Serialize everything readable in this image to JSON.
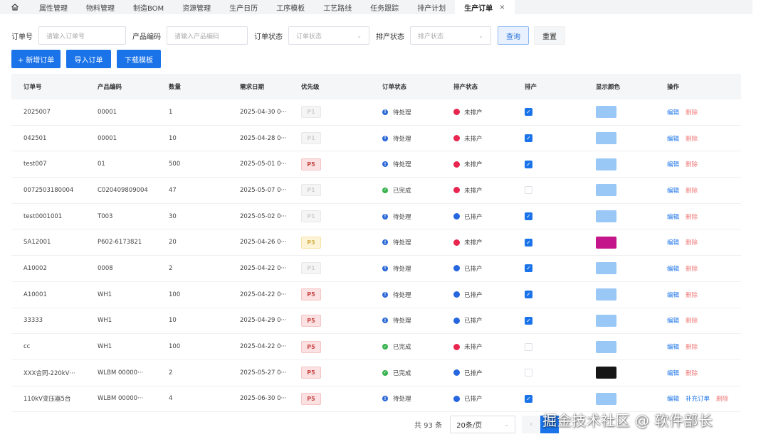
{
  "tabs": [
    {
      "label": "属性管理"
    },
    {
      "label": "物料管理"
    },
    {
      "label": "制造BOM"
    },
    {
      "label": "资源管理"
    },
    {
      "label": "生产日历"
    },
    {
      "label": "工序模板"
    },
    {
      "label": "工艺路线"
    },
    {
      "label": "任务跟踪"
    },
    {
      "label": "排产计划"
    },
    {
      "label": "生产订单",
      "active": true
    }
  ],
  "filters": {
    "order_no_label": "订单号",
    "order_no_placeholder": "请输入订单号",
    "product_code_label": "产品编码",
    "product_code_placeholder": "请输入产品编码",
    "order_status_label": "订单状态",
    "order_status_placeholder": "订单状态",
    "schedule_status_label": "排产状态",
    "schedule_status_placeholder": "排产状态",
    "query_label": "查询",
    "reset_label": "重置"
  },
  "actions": {
    "add_label": "+ 新增订单",
    "import_label": "导入订单",
    "download_label": "下载模板"
  },
  "table": {
    "headers": [
      "订单号",
      "产品编码",
      "数量",
      "需求日期",
      "优先级",
      "订单状态",
      "排产状态",
      "排产",
      "显示颜色",
      "操作"
    ],
    "rows": [
      {
        "order": "2025007",
        "code": "00001",
        "qty": "1",
        "date": "2025-04-30 0···",
        "prio": "P1",
        "ostatus": "待处理",
        "sstatus": "未排产",
        "checked": true,
        "color": "#99c8f7"
      },
      {
        "order": "042501",
        "code": "00001",
        "qty": "10",
        "date": "2025-04-28 0···",
        "prio": "P1",
        "ostatus": "待处理",
        "sstatus": "未排产",
        "checked": true,
        "color": "#99c8f7"
      },
      {
        "order": "test007",
        "code": "01",
        "qty": "500",
        "date": "2025-05-01 0···",
        "prio": "P5",
        "ostatus": "待处理",
        "sstatus": "未排产",
        "checked": true,
        "color": "#99c8f7"
      },
      {
        "order": "0072503180004",
        "code": "C020409809004",
        "qty": "47",
        "date": "2025-05-07 0···",
        "prio": "P1",
        "ostatus": "已完成",
        "sstatus": "未排产",
        "checked": false,
        "color": "#99c8f7"
      },
      {
        "order": "test0001001",
        "code": "T003",
        "qty": "30",
        "date": "2025-05-02 0···",
        "prio": "P1",
        "ostatus": "待处理",
        "sstatus": "已排产",
        "checked": true,
        "color": "#99c8f7"
      },
      {
        "order": "SA12001",
        "code": "P602-6173821",
        "qty": "20",
        "date": "2025-04-26 0···",
        "prio": "P3",
        "ostatus": "待处理",
        "sstatus": "未排产",
        "checked": true,
        "color": "#c4168a"
      },
      {
        "order": "A10002",
        "code": "0008",
        "qty": "2",
        "date": "2025-04-22 0···",
        "prio": "P1",
        "ostatus": "待处理",
        "sstatus": "已排产",
        "checked": true,
        "color": "#99c8f7"
      },
      {
        "order": "A10001",
        "code": "WH1",
        "qty": "100",
        "date": "2025-04-22 0···",
        "prio": "P5",
        "ostatus": "待处理",
        "sstatus": "已排产",
        "checked": true,
        "color": "#99c8f7"
      },
      {
        "order": "33333",
        "code": "WH1",
        "qty": "10",
        "date": "2025-04-29 0···",
        "prio": "P5",
        "ostatus": "待处理",
        "sstatus": "已排产",
        "checked": true,
        "color": "#99c8f7"
      },
      {
        "order": "cc",
        "code": "WH1",
        "qty": "100",
        "date": "2025-04-22 0···",
        "prio": "P5",
        "ostatus": "已完成",
        "sstatus": "未排产",
        "checked": false,
        "color": "#99c8f7"
      },
      {
        "order": "XXX合同-220kV···",
        "code": "WLBM 00000···",
        "qty": "2",
        "date": "2025-05-27 0···",
        "prio": "P5",
        "ostatus": "已完成",
        "sstatus": "已排产",
        "checked": false,
        "color": "#161616"
      },
      {
        "order": "110kV变压器5台",
        "code": "WLBM 00000···",
        "qty": "4",
        "date": "2025-06-30 0···",
        "prio": "P5",
        "ostatus": "待处理",
        "sstatus": "已排产",
        "checked": true,
        "color": "#99c8f7",
        "extra": "补充订单"
      }
    ],
    "edit_label": "编辑",
    "delete_label": "删除"
  },
  "colors": {
    "primary": "#1a73e8",
    "info": "#2b68d8",
    "done": "#37b24d",
    "unscheduled": "#e8264f",
    "scheduled": "#2667e0"
  },
  "pagination": {
    "total": "共 93 条",
    "page_size": "20条/页",
    "current": "1"
  },
  "watermark": "掘金技术社区 @ 软件部长"
}
